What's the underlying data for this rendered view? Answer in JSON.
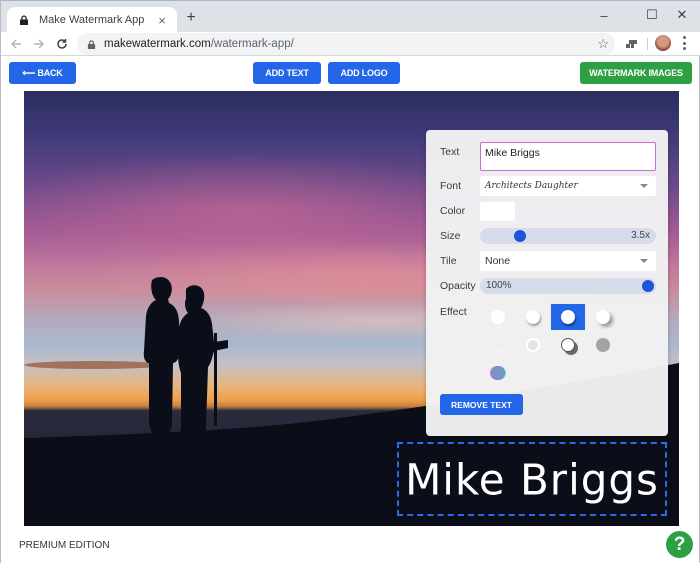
{
  "browser": {
    "tab_title": "Make Watermark App",
    "tab_close": "×",
    "new_tab": "+",
    "url_host": "makewatermark.com",
    "url_path": "/watermark-app/",
    "icons": {
      "back": "arrow-left-icon",
      "forward": "arrow-right-icon",
      "reload": "reload-icon",
      "lock": "lock-icon",
      "star": "star-icon",
      "extension": "extension-icon",
      "profile": "avatar",
      "menu": "kebab-menu-icon"
    },
    "window_controls": {
      "minimize": "–",
      "maximize": "☐",
      "close": "✕"
    }
  },
  "header": {
    "back_label": "⟵ BACK",
    "add_text_label": "ADD TEXT",
    "add_logo_label": "ADD LOGO",
    "watermark_images_label": "WATERMARK IMAGES"
  },
  "panel": {
    "text_label": "Text",
    "text_value": "Mike Briggs",
    "font_label": "Font",
    "font_value": "Architects Daughter",
    "color_label": "Color",
    "color_value": "#ffffff",
    "size_label": "Size",
    "size_value": "3.5x",
    "size_fraction": 0.2,
    "tile_label": "Tile",
    "tile_value": "None",
    "opacity_label": "Opacity",
    "opacity_value": "100%",
    "opacity_fraction": 1.0,
    "effect_label": "Effect",
    "effects": [
      {
        "name": "none",
        "selected": false
      },
      {
        "name": "soft-shadow",
        "selected": false
      },
      {
        "name": "drop-shadow",
        "selected": true
      },
      {
        "name": "long-shadow",
        "selected": false
      },
      {
        "name": "faint-outline",
        "selected": false
      },
      {
        "name": "outline",
        "selected": false
      },
      {
        "name": "offset-shadow",
        "selected": false
      },
      {
        "name": "gray",
        "selected": false
      },
      {
        "name": "chromatic",
        "selected": false
      }
    ],
    "remove_label": "REMOVE TEXT"
  },
  "watermark": {
    "text": "Mike Briggs",
    "color": "#ffffff",
    "selection_color": "#2a6ae8"
  },
  "footer": {
    "edition_label": "PREMIUM EDITION",
    "help_label": "?"
  },
  "colors": {
    "primary": "#2366e8",
    "success": "#2ea044"
  }
}
